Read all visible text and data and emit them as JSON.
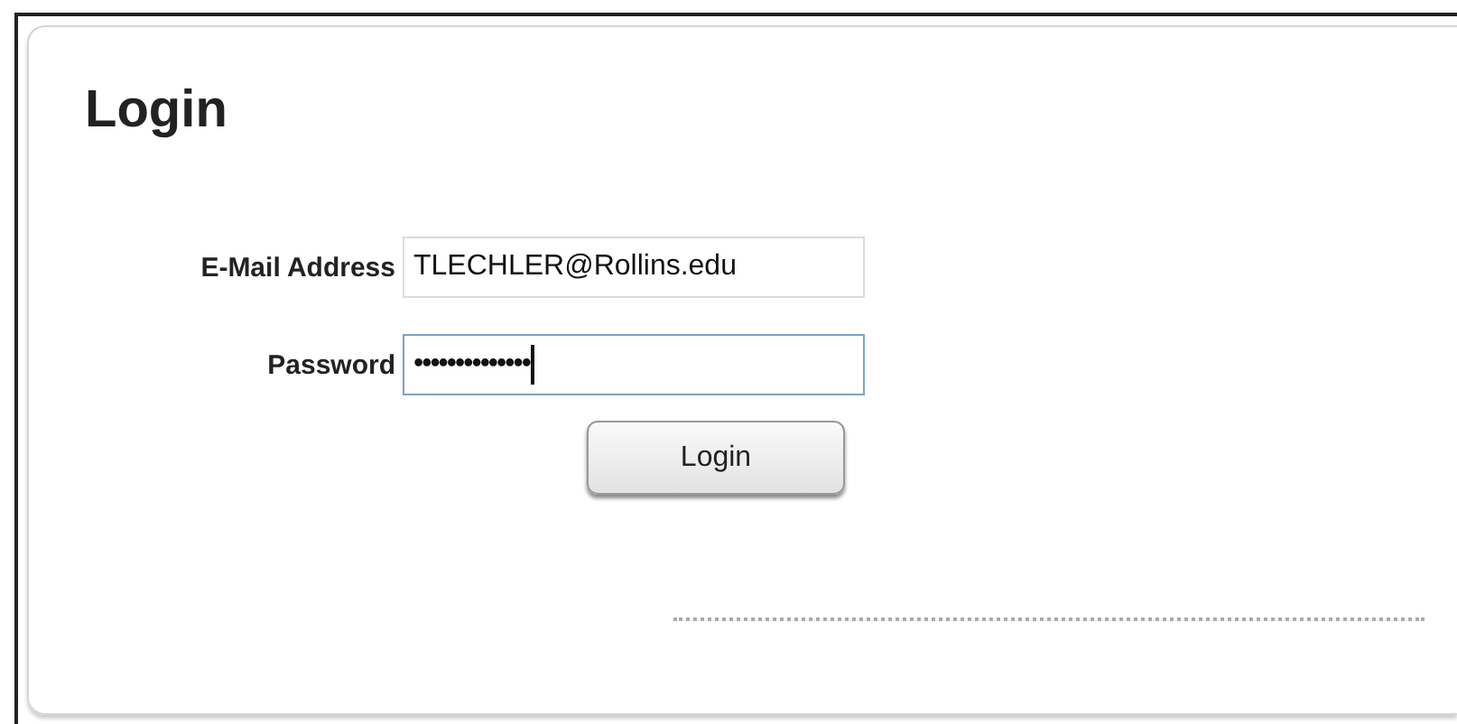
{
  "title": "Login",
  "fields": [
    {
      "label": "E-Mail Address",
      "value": "TLECHLER@Rollins.edu",
      "focused": false
    },
    {
      "label": "Password",
      "value": "••••••••••••••",
      "focused": true
    }
  ],
  "button": "Login"
}
